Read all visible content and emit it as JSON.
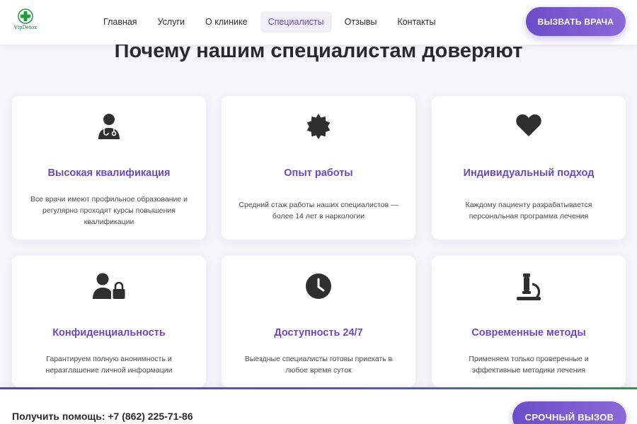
{
  "header": {
    "logo_text": "VipDetox",
    "nav": [
      {
        "label": "Главная",
        "active": false
      },
      {
        "label": "Услуги",
        "active": false
      },
      {
        "label": "О клинике",
        "active": false
      },
      {
        "label": "Специалисты",
        "active": true
      },
      {
        "label": "Отзывы",
        "active": false
      },
      {
        "label": "Контакты",
        "active": false
      }
    ],
    "cta_label": "ВЫЗВАТЬ ВРАЧА"
  },
  "section": {
    "title": "Почему нашим специалистам доверяют"
  },
  "cards": [
    {
      "icon": "doctor-icon",
      "title": "Высокая квалификация",
      "text": "Все врачи имеют профильное образование и регулярно проходят курсы повышения квалификации"
    },
    {
      "icon": "badge-icon",
      "title": "Опыт работы",
      "text": "Средний стаж работы наших специалистов — более 14 лет в наркологии"
    },
    {
      "icon": "heart-icon",
      "title": "Индивидуальный подход",
      "text": "Каждому пациенту разрабатывается персональная программа лечения"
    },
    {
      "icon": "user-lock-icon",
      "title": "Конфиденциальность",
      "text": "Гарантируем полную анонимность и неразглашение личной информации"
    },
    {
      "icon": "clock-icon",
      "title": "Доступность 24/7",
      "text": "Выездные специалисты готовы приехать в любое время суток"
    },
    {
      "icon": "microscope-icon",
      "title": "Современные методы",
      "text": "Применяем только проверенные и эффективные методики лечения"
    }
  ],
  "bottom_bar": {
    "help_text": "Получить помощь: +7 (862) 225-71-86",
    "cta_label": "СРОЧНЫЙ ВЫЗОВ"
  },
  "colors": {
    "accent": "#6b47c4",
    "button_gradient_start": "#6b4dc8",
    "button_gradient_end": "#8a6ad8",
    "icon_color": "#2f2f2f",
    "logo_green": "#1f9a3c"
  }
}
